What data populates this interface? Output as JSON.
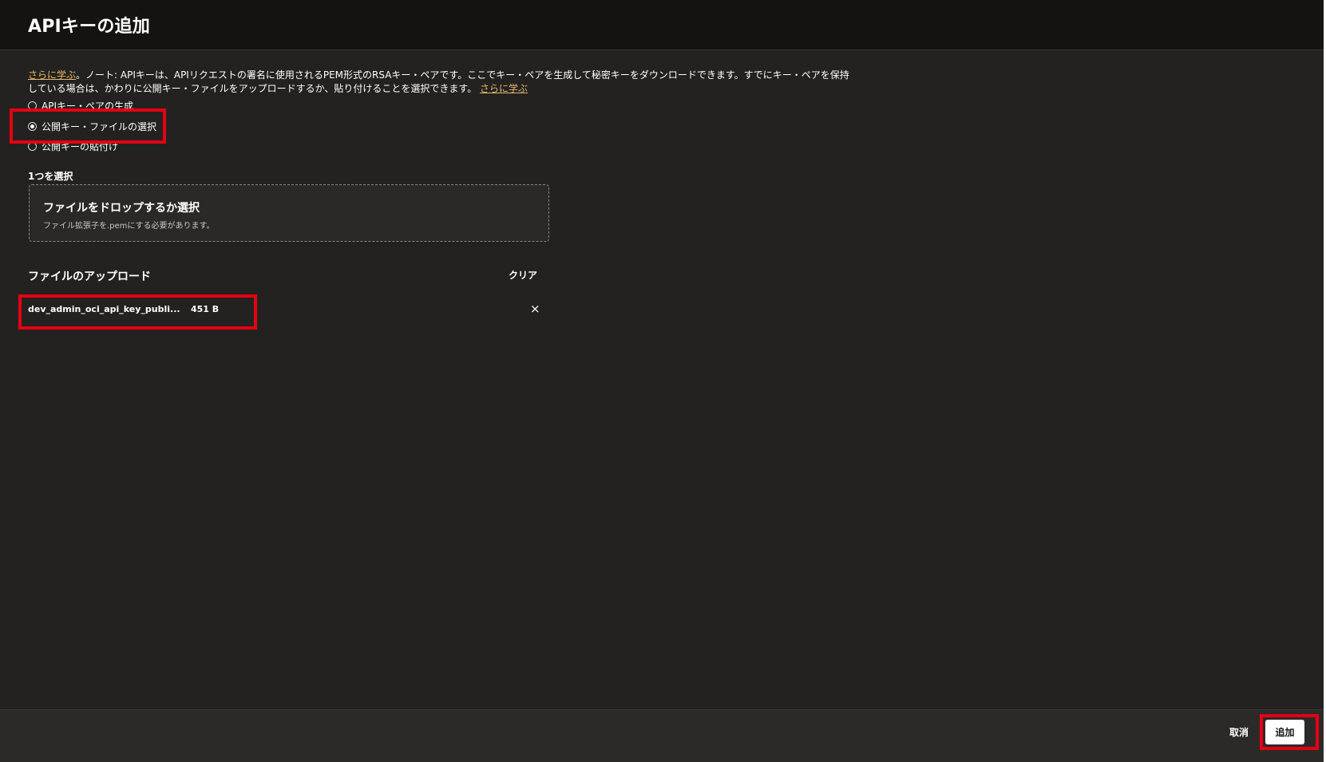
{
  "dialog": {
    "title": "APIキーの追加"
  },
  "note": {
    "link_text": "さらに学ぶ",
    "text": "。ノート: APIキーは、APIリクエストの署名に使用されるPEM形式のRSAキー・ペアです。ここでキー・ペアを生成して秘密キーをダウンロードできます。すでにキー・ペアを保持している場合は、かわりに公開キー・ファイルをアップロードするか、貼り付けることを選択できます。",
    "link_text_end": "さらに学ぶ"
  },
  "options": [
    {
      "label": "APIキー・ペアの生成",
      "checked": false
    },
    {
      "label": "公開キー・ファイルの選択",
      "checked": true
    },
    {
      "label": "公開キーの貼付け",
      "checked": false
    }
  ],
  "dropzone": {
    "label": "1つを選択",
    "title": "ファイルをドロップするか選択",
    "hint": "ファイル拡張子を.pemにする必要があります。"
  },
  "upload": {
    "title": "ファイルのアップロード",
    "clear_label": "クリア",
    "files": [
      {
        "name": "dev_admin_oci_api_key_publi...",
        "size": "451 B"
      }
    ],
    "remove_icon": "×"
  },
  "footer": {
    "cancel_label": "取消",
    "add_label": "追加"
  },
  "colors": {
    "background": "#232221",
    "header": "#141312",
    "link": "#e9b868",
    "highlight": "#e50012"
  }
}
